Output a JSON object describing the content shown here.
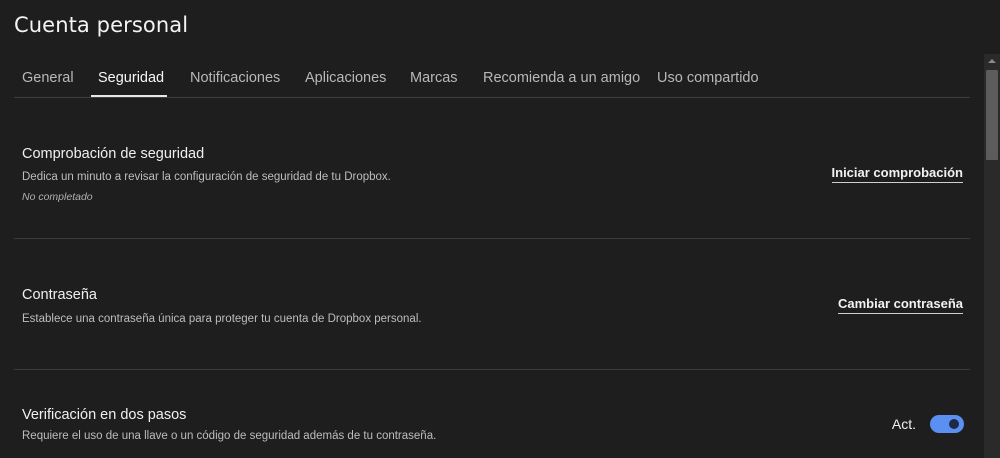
{
  "page": {
    "title": "Cuenta personal"
  },
  "tabs": [
    {
      "label": "General"
    },
    {
      "label": "Seguridad",
      "active": true
    },
    {
      "label": "Notificaciones"
    },
    {
      "label": "Aplicaciones"
    },
    {
      "label": "Marcas"
    },
    {
      "label": "Recomienda a un amigo"
    },
    {
      "label": "Uso compartido"
    }
  ],
  "sections": {
    "security_check": {
      "title": "Comprobación de seguridad",
      "description": "Dedica un minuto a revisar la configuración de seguridad de tu Dropbox.",
      "status": "No completado",
      "action": "Iniciar comprobación"
    },
    "password": {
      "title": "Contraseña",
      "description": "Establece una contraseña única para proteger tu cuenta de Dropbox personal.",
      "action": "Cambiar contraseña"
    },
    "two_step": {
      "title": "Verificación en dos pasos",
      "description": "Requiere el uso de una llave o un código de seguridad además de tu contraseña.",
      "toggle_label": "Act.",
      "enabled": true
    }
  },
  "colors": {
    "background": "#1e1e1e",
    "toggle_on": "#5b8ff2"
  }
}
